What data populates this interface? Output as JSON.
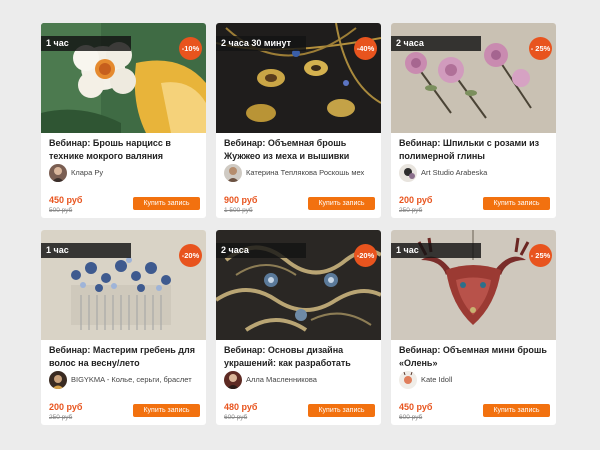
{
  "cards": [
    {
      "duration": "1 час",
      "discount": "-10%",
      "title": "Вебинар: Брошь нарцисс в технике мокрого валяния",
      "author": "Клара Ру",
      "price": "450 руб",
      "old_price": "500 руб",
      "buy_label": "Купить запись"
    },
    {
      "duration": "2 часа 30 минут",
      "discount": "-40%",
      "title": "Вебинар: Объемная брошь Жужжео из меха и вышивки",
      "author": "Катерина Теплякова Роскошь мех",
      "price": "900 руб",
      "old_price": "1 500 руб",
      "buy_label": "Купить запись"
    },
    {
      "duration": "2 часа",
      "discount": "- 25%",
      "title": "Вебинар: Шпильки с розами из полимерной глины",
      "author": "Art Studio Arabeska",
      "price": "200 руб",
      "old_price": "250 руб",
      "buy_label": "Купить запись"
    },
    {
      "duration": "1 час",
      "discount": "-20%",
      "title": "Вебинар: Мастерим гребень для волос на весну/лето",
      "author": "BIGYKMA - Колье, серьги, браслет",
      "price": "200 руб",
      "old_price": "250 руб",
      "buy_label": "Купить запись"
    },
    {
      "duration": "2 часа",
      "discount": "-20%",
      "title": "Вебинар: Основы дизайна украшений: как разработать",
      "author": "Алла Масленникова",
      "price": "480 руб",
      "old_price": "600 руб",
      "buy_label": "Купить запись"
    },
    {
      "duration": "1 час",
      "discount": "- 25%",
      "title": "Вебинар: Объемная мини брошь «Олень»",
      "author": "Kate Idoll",
      "price": "450 руб",
      "old_price": "600 руб",
      "buy_label": "Купить запись"
    }
  ]
}
